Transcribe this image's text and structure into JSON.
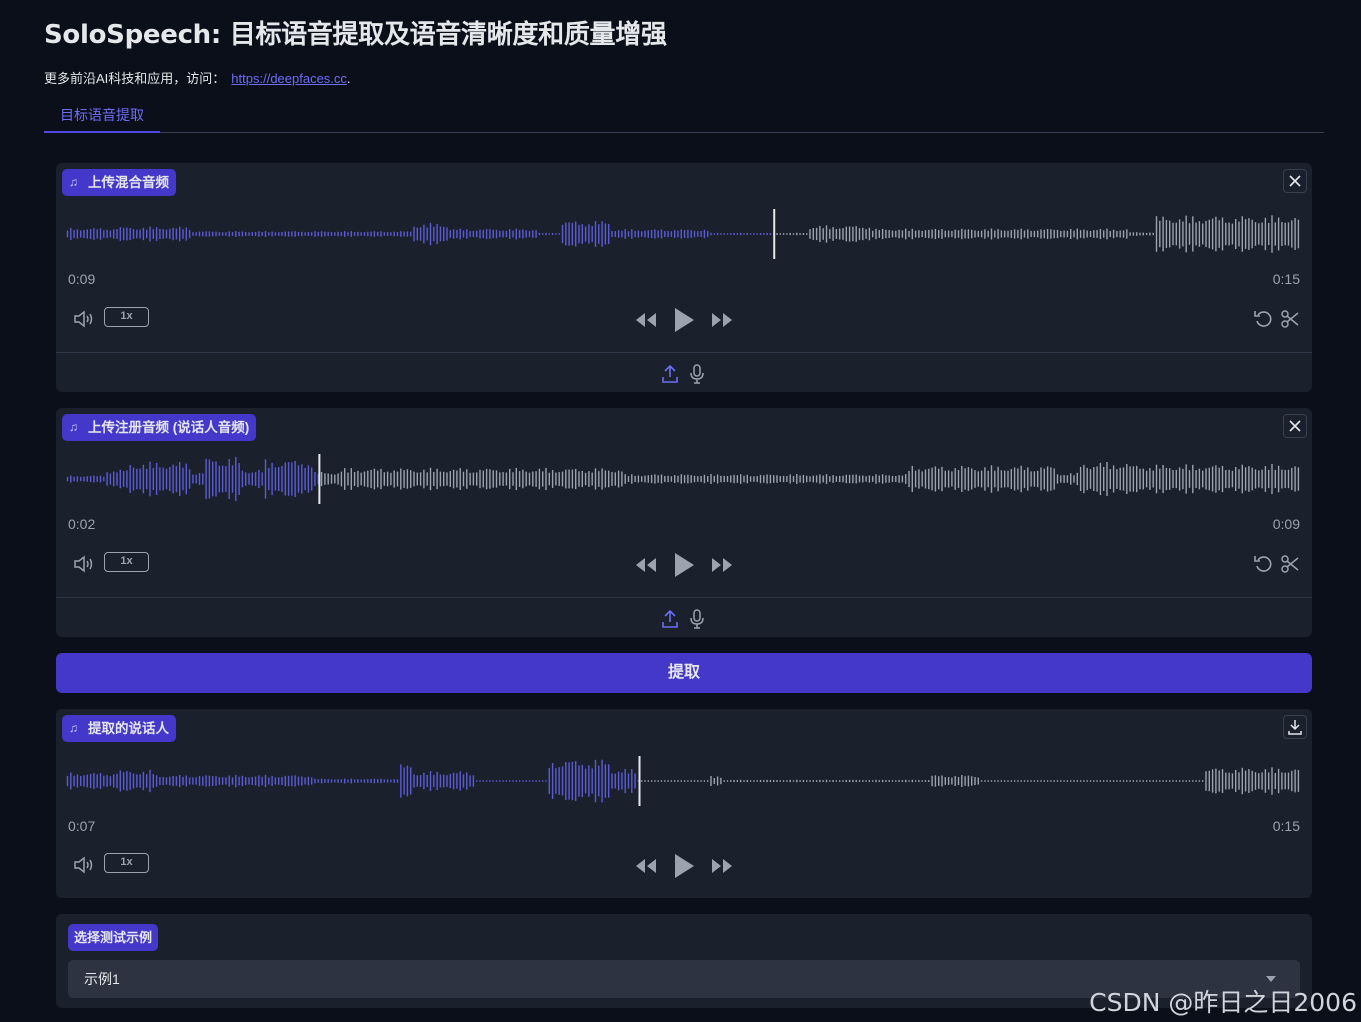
{
  "header": {
    "title": "SoloSpeech: 目标语音提取及语音清晰度和质量增强",
    "subtitle_prefix": "更多前沿AI科技和应用，访问：",
    "link_text": "https://deepfaces.cc",
    "subtitle_suffix": "."
  },
  "tabs": [
    {
      "label": "目标语音提取"
    }
  ],
  "panels": [
    {
      "label": "上传混合音频",
      "current": "0:09",
      "duration": "0:15",
      "progress": 0.573,
      "rate": "1x",
      "corner": "close-icon"
    },
    {
      "label": "上传注册音频 (说话人音频)",
      "current": "0:02",
      "duration": "0:09",
      "progress": 0.205,
      "rate": "1x",
      "corner": "close-icon"
    },
    {
      "label": "提取的说话人",
      "current": "0:07",
      "duration": "0:15",
      "progress": 0.464,
      "rate": "1x",
      "corner": "download-icon"
    }
  ],
  "extract_button": {
    "label": "提取"
  },
  "examples": {
    "label": "选择测试示例",
    "selected": "示例1"
  },
  "watermark": "CSDN @昨日之日2006",
  "colors": {
    "background": "#0b0f19",
    "panel": "#1a202c",
    "accent": "#4338ca",
    "played": "#5b5bd6",
    "unplayed": "#9ca3af"
  }
}
